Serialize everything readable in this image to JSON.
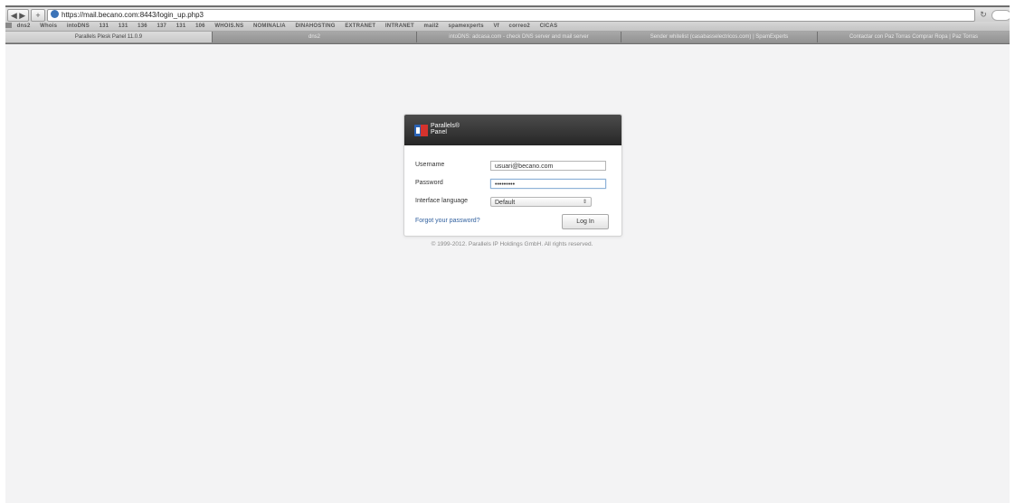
{
  "browser": {
    "url": "https://mail.becano.com:8443/login_up.php3",
    "reload_glyph": "↻",
    "back_forward_glyph": "◀ ▶",
    "add_glyph": "+",
    "bookmarks": [
      "dns2",
      "Whois",
      "intoDNS",
      "131",
      "131",
      "136",
      "137",
      "131",
      "106",
      "WHOIS.NS",
      "NOMINALIA",
      "DINAHOSTING",
      "EXTRANET",
      "INTRANET",
      "mail2",
      "spamexperts",
      "Vf",
      "correo2",
      "CICAS"
    ],
    "tabs": [
      "Parallels Plesk Panel 11.0.9",
      "dns2",
      "intoDNS: adcasa.com - check DNS server and mail server",
      "Sender whitelist (casabasselectricos.com) | SpamExperts",
      "Contactar con Paz Torras Comprar Ropa | Paz Torras"
    ]
  },
  "login": {
    "brand_line1": "Parallels®",
    "brand_line2": "Panel",
    "username_label": "Username",
    "username_value": "usuari@becano.com",
    "password_label": "Password",
    "password_value": "•••••••••",
    "language_label": "Interface language",
    "language_value": "Default",
    "select_arrow": "⇕",
    "forgot_link": "Forgot your password?",
    "login_button": "Log In"
  },
  "footer": {
    "copyright": "© 1999-2012. Parallels IP Holdings GmbH. All rights reserved."
  },
  "colors": {
    "page_background": "#f3f3f4",
    "header_dark": "#2b2b2b",
    "link_blue": "#2f5f9e",
    "logo_blue": "#2b63b5",
    "logo_red": "#d5332d"
  }
}
